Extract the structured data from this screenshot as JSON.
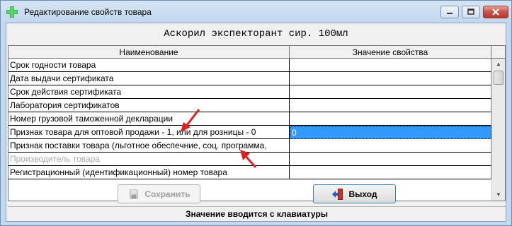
{
  "window": {
    "title": "Редактирование свойств товара"
  },
  "product": {
    "title": "Аскорил экспекторант сир. 100мл"
  },
  "table": {
    "columns": [
      "Наименование",
      "Значение свойства"
    ],
    "rows": [
      {
        "name": "Срок годности товара",
        "value": ""
      },
      {
        "name": "Дата выдачи сертификата",
        "value": ""
      },
      {
        "name": "Срок действия сертификата",
        "value": ""
      },
      {
        "name": "Лаборатория сертификатов",
        "value": ""
      },
      {
        "name": "Номер грузовой таможенной декларации",
        "value": ""
      },
      {
        "name": "Признак товара для оптовой продажи - 1, или для розницы - 0",
        "value": "0"
      },
      {
        "name": "Признак поставки товара (льготное обеспечние, соц. программа,",
        "value": ""
      },
      {
        "name": "Производитель товара",
        "value": ""
      },
      {
        "name": "Регистрационный (идентификационный) номер товара",
        "value": ""
      }
    ]
  },
  "buttons": {
    "save_label": "Сохранить",
    "exit_label": "Выход"
  },
  "status": {
    "text": "Значение вводится с клавиатуры"
  },
  "colors": {
    "selection": "#3399ff",
    "annotation_arrow": "#e02020",
    "app_icon": "#2db34a"
  }
}
